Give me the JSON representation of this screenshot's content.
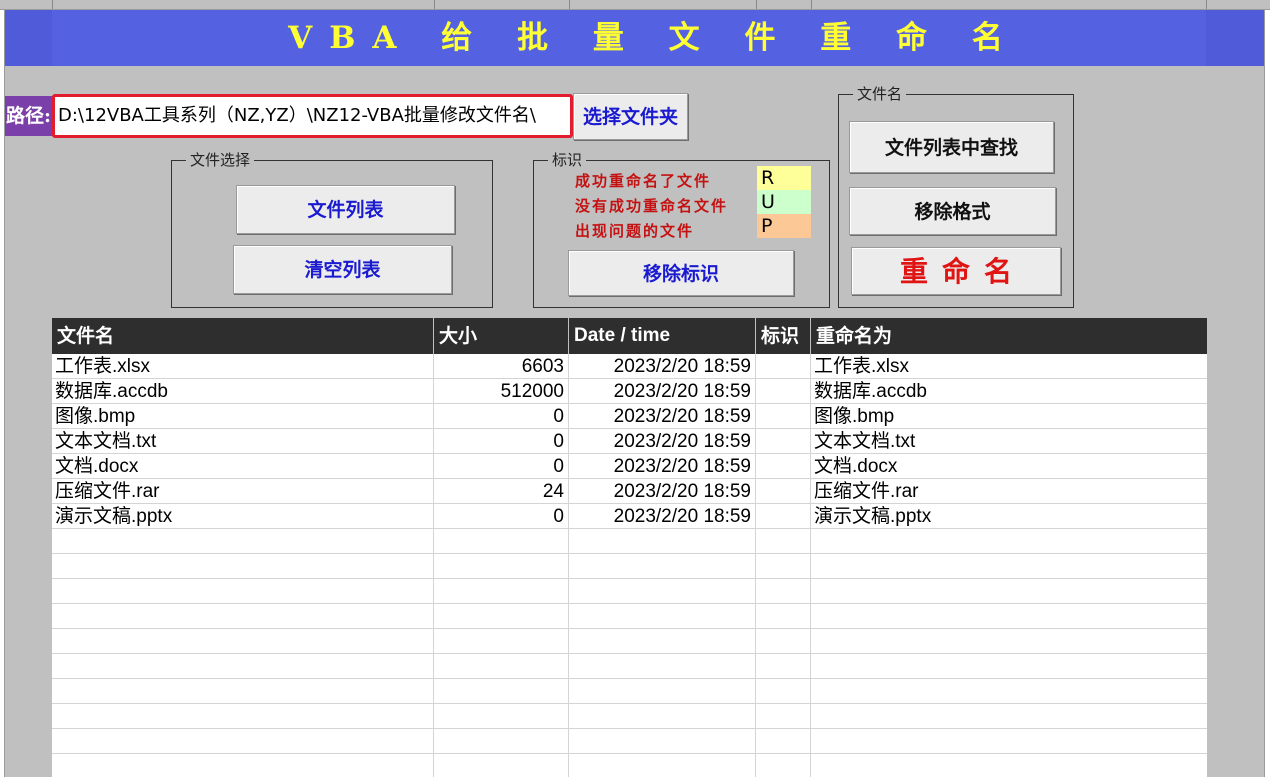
{
  "title": "VBA 给 批 量 文 件 重 命 名",
  "path": {
    "label": "路径:",
    "value": "D:\\12VBA工具系列（NZ,YZ）\\NZ12-VBA批量修改文件名\\",
    "browse_button": "选择文件夹"
  },
  "file_select_group": {
    "title": "文件选择",
    "list_button": "文件列表",
    "clear_button": "清空列表"
  },
  "marker_group": {
    "title": "标识",
    "legend": [
      {
        "text": "成功重命名了文件",
        "code": "R",
        "color": "#ffff99"
      },
      {
        "text": "没有成功重命名文件",
        "code": "U",
        "color": "#ccffcc"
      },
      {
        "text": "出现问题的文件",
        "code": "P",
        "color": "#fcc896"
      }
    ],
    "remove_button": "移除标识"
  },
  "filename_group": {
    "title": "文件名",
    "find_button": "文件列表中查找",
    "remove_format_button": "移除格式",
    "rename_button": "重命名"
  },
  "table": {
    "headers": [
      "文件名",
      "大小",
      "Date / time",
      "标识",
      "重命名为"
    ],
    "rows": [
      {
        "name": "工作表.xlsx",
        "size": "6603",
        "date": "2023/2/20 18:59",
        "mark": "",
        "rename": "工作表.xlsx"
      },
      {
        "name": "数据库.accdb",
        "size": "512000",
        "date": "2023/2/20 18:59",
        "mark": "",
        "rename": "数据库.accdb"
      },
      {
        "name": "图像.bmp",
        "size": "0",
        "date": "2023/2/20 18:59",
        "mark": "",
        "rename": "图像.bmp"
      },
      {
        "name": "文本文档.txt",
        "size": "0",
        "date": "2023/2/20 18:59",
        "mark": "",
        "rename": "文本文档.txt"
      },
      {
        "name": "文档.docx",
        "size": "0",
        "date": "2023/2/20 18:59",
        "mark": "",
        "rename": "文档.docx"
      },
      {
        "name": "压缩文件.rar",
        "size": "24",
        "date": "2023/2/20 18:59",
        "mark": "",
        "rename": "压缩文件.rar"
      },
      {
        "name": "演示文稿.pptx",
        "size": "0",
        "date": "2023/2/20 18:59",
        "mark": "",
        "rename": "演示文稿.pptx"
      }
    ]
  }
}
